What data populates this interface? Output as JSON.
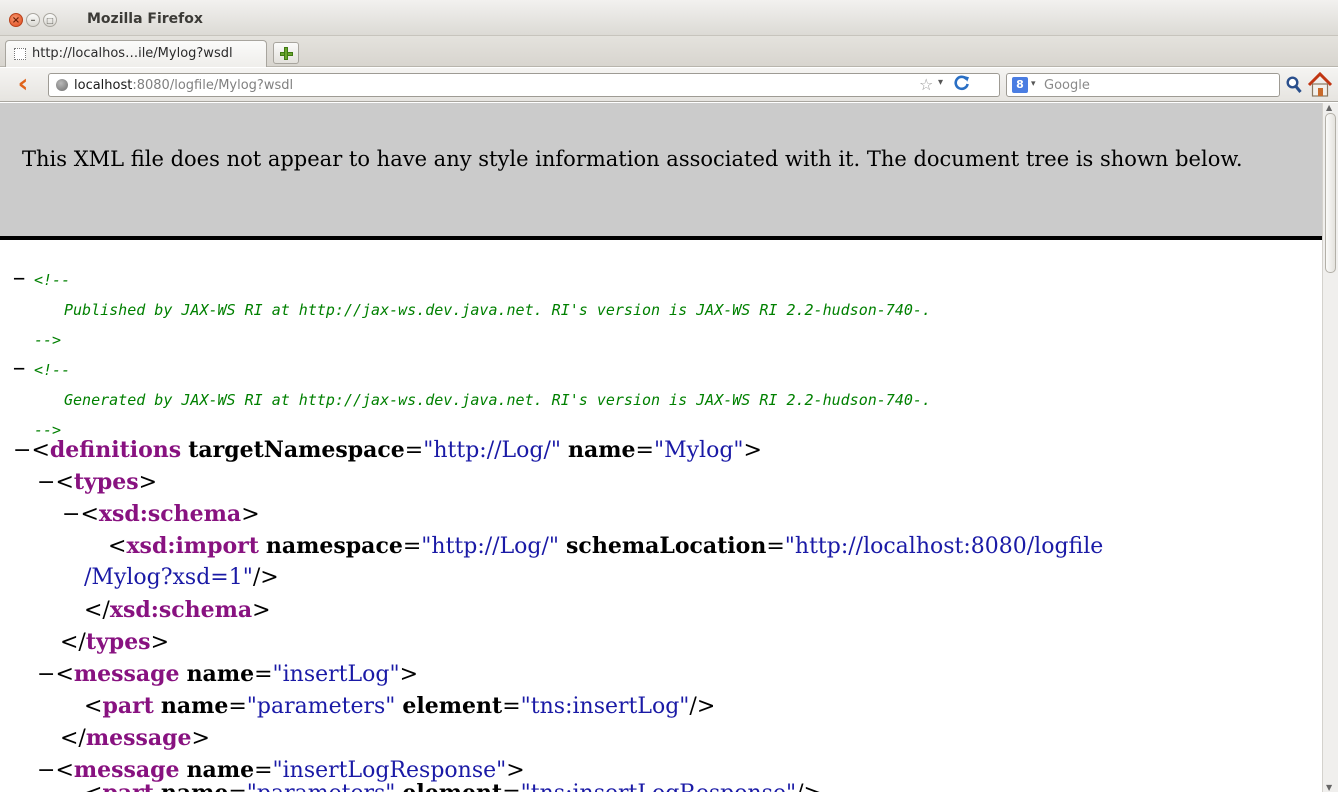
{
  "window": {
    "title": "Mozilla Firefox",
    "close_glyph": "×",
    "min_glyph": "–",
    "max_glyph": "□"
  },
  "tabs": [
    {
      "label": "http://localhos…ile/Mylog?wsdl"
    }
  ],
  "navbar": {
    "back_glyph": "‹",
    "url_host": "localhost",
    "url_rest": ":8080/logfile/Mylog?wsdl",
    "star_glyph": "☆",
    "dropdown_glyph": "▾",
    "reload_glyph": "C",
    "search_engine_glyph": "8",
    "search_placeholder": "Google",
    "icons": [
      "back-icon",
      "globe-icon",
      "bookmark-star-icon",
      "reload-icon",
      "google-icon",
      "search-icon",
      "home-icon"
    ]
  },
  "content": {
    "header_text": "This XML file does not appear to have any style information associated with it. The document tree is shown below.",
    "comments": [
      {
        "open": "<!--",
        "text": "Published by JAX-WS RI at http://jax-ws.dev.java.net. RI's version is JAX-WS RI 2.2-hudson-740-.",
        "close": "-->"
      },
      {
        "open": "<!--",
        "text": "Generated by JAX-WS RI at http://jax-ws.dev.java.net. RI's version is JAX-WS RI 2.2-hudson-740-.",
        "close": "-->"
      }
    ],
    "collapse_glyph": "−",
    "definitions": {
      "tag": "definitions",
      "attr1": "targetNamespace",
      "val1": "\"http://Log/\"",
      "attr2": "name",
      "val2": "\"Mylog\""
    },
    "types": {
      "tag": "types"
    },
    "schema": {
      "tag": "xsd:schema"
    },
    "import": {
      "tag": "xsd:import",
      "attr1": "namespace",
      "val1": "\"http://Log/\"",
      "attr2": "schemaLocation",
      "val2a": "\"http://localhost:8080/logfile",
      "val2b": "/Mylog?xsd=1\""
    },
    "message1": {
      "tag": "message",
      "attr": "name",
      "val": "\"insertLog\""
    },
    "part1": {
      "tag": "part",
      "attr1": "name",
      "val1": "\"parameters\"",
      "attr2": "element",
      "val2": "\"tns:insertLog\""
    },
    "message2": {
      "tag": "message",
      "attr": "name",
      "val": "\"insertLogResponse\""
    },
    "part2": {
      "tag": "part",
      "attr1": "name",
      "val1": "\"parameters\"",
      "attr2": "element",
      "val2": "\"tns:insertLogResponse\""
    }
  },
  "colors": {
    "tag": "#881280",
    "value": "#1a1aa6",
    "comment": "#008000",
    "header_bg": "#cbcbcb"
  }
}
